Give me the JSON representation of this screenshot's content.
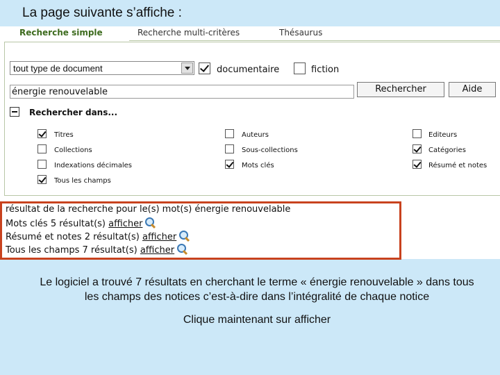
{
  "slide_title": "La page suivante s’affiche :",
  "tabs": [
    {
      "label": "Recherche simple"
    },
    {
      "label": "Recherche multi-critères"
    },
    {
      "label": "Thésaurus"
    }
  ],
  "form": {
    "doc_type": "tout type de document",
    "documentaire_label": "documentaire",
    "documentaire_checked": true,
    "fiction_label": "fiction",
    "fiction_checked": false,
    "search_value": "énergie renouvelable",
    "search_button": "Rechercher",
    "help_button": "Aide",
    "section_title": "Rechercher dans..."
  },
  "fields": [
    {
      "label": "Titres",
      "checked": true
    },
    {
      "label": "Auteurs",
      "checked": false
    },
    {
      "label": "Editeurs",
      "checked": false
    },
    {
      "label": "Collections",
      "checked": false
    },
    {
      "label": "Sous-collections",
      "checked": false
    },
    {
      "label": "Catégories",
      "checked": true
    },
    {
      "label": "Indexations décimales",
      "checked": false
    },
    {
      "label": "Mots clés",
      "checked": true
    },
    {
      "label": "Résumé et notes",
      "checked": true
    },
    {
      "label": "Tous les champs",
      "checked": true
    }
  ],
  "results": {
    "title": "résultat de la recherche pour le(s) mot(s) énergie renouvelable",
    "rows": [
      {
        "field": "Mots clés",
        "count": "5 résultat(s)",
        "link": "afficher"
      },
      {
        "field": "Résumé et notes",
        "count": "2 résultat(s)",
        "link": "afficher"
      },
      {
        "field": "Tous les champs",
        "count": "7 résultat(s)",
        "link": "afficher"
      }
    ]
  },
  "caption": {
    "line1": "Le logiciel a trouvé 7 résultats en cherchant le terme « énergie renouvelable » dans tous",
    "line2": "les champs des notices c’est-à-dire dans l’intégralité de chaque notice",
    "line3": "Clique maintenant sur afficher"
  }
}
